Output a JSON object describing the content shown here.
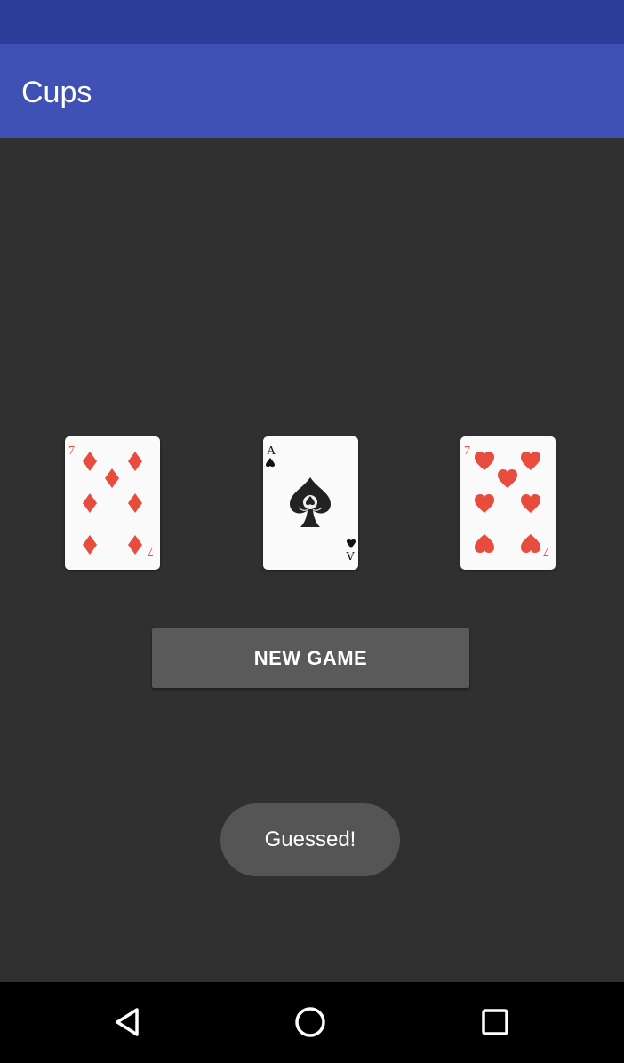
{
  "app_bar": {
    "title": "Cups",
    "color": "#3f51b5",
    "status_bar_color": "#2f3d9a"
  },
  "cards": [
    {
      "rank": "7",
      "suit": "diamonds",
      "color": "#e74c3c"
    },
    {
      "rank": "A",
      "suit": "spades",
      "color": "#111111"
    },
    {
      "rank": "7",
      "suit": "hearts",
      "color": "#e74c3c"
    }
  ],
  "new_game_button": {
    "label": "NEW GAME"
  },
  "toast": {
    "text": "Guessed!"
  },
  "nav_bar": {
    "back_icon": "back-triangle-icon",
    "home_icon": "home-circle-icon",
    "recents_icon": "recents-square-icon"
  }
}
